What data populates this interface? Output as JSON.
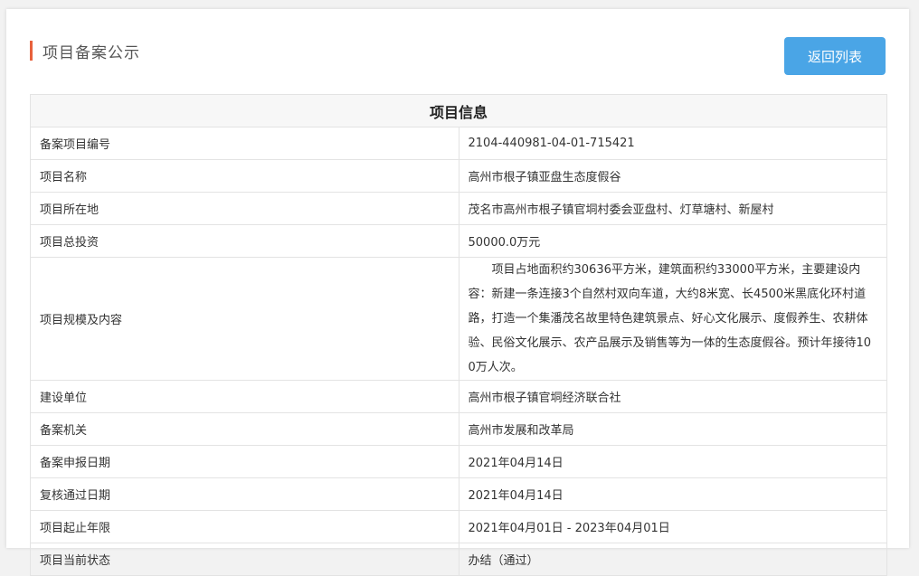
{
  "header": {
    "title": "项目备案公示",
    "back_label": "返回列表"
  },
  "table": {
    "heading": "项目信息",
    "rows": [
      {
        "label": "备案项目编号",
        "value": "2104-440981-04-01-715421"
      },
      {
        "label": "项目名称",
        "value": "高州市根子镇亚盘生态度假谷"
      },
      {
        "label": "项目所在地",
        "value": "茂名市高州市根子镇官垌村委会亚盘村、灯草塘村、新屋村"
      },
      {
        "label": "项目总投资",
        "value": "50000.0万元"
      },
      {
        "label": "项目规模及内容",
        "value": "项目占地面积约30636平方米，建筑面积约33000平方米，主要建设内容：新建一条连接3个自然村双向车道，大约8米宽、长4500米黑底化环村道路，打造一个集潘茂名故里特色建筑景点、好心文化展示、度假养生、农耕体验、民俗文化展示、农产品展示及销售等为一体的生态度假谷。预计年接待100万人次。"
      },
      {
        "label": "建设单位",
        "value": "高州市根子镇官垌经济联合社"
      },
      {
        "label": "备案机关",
        "value": "高州市发展和改革局"
      },
      {
        "label": "备案申报日期",
        "value": "2021年04月14日"
      },
      {
        "label": "复核通过日期",
        "value": "2021年04月14日"
      },
      {
        "label": "项目起止年限",
        "value": "2021年04月01日 - 2023年04月01日"
      },
      {
        "label": "项目当前状态",
        "value": "办结（通过）"
      }
    ]
  },
  "colors": {
    "accent_bar": "#e8613c",
    "button_bg": "#4aa5e6"
  }
}
